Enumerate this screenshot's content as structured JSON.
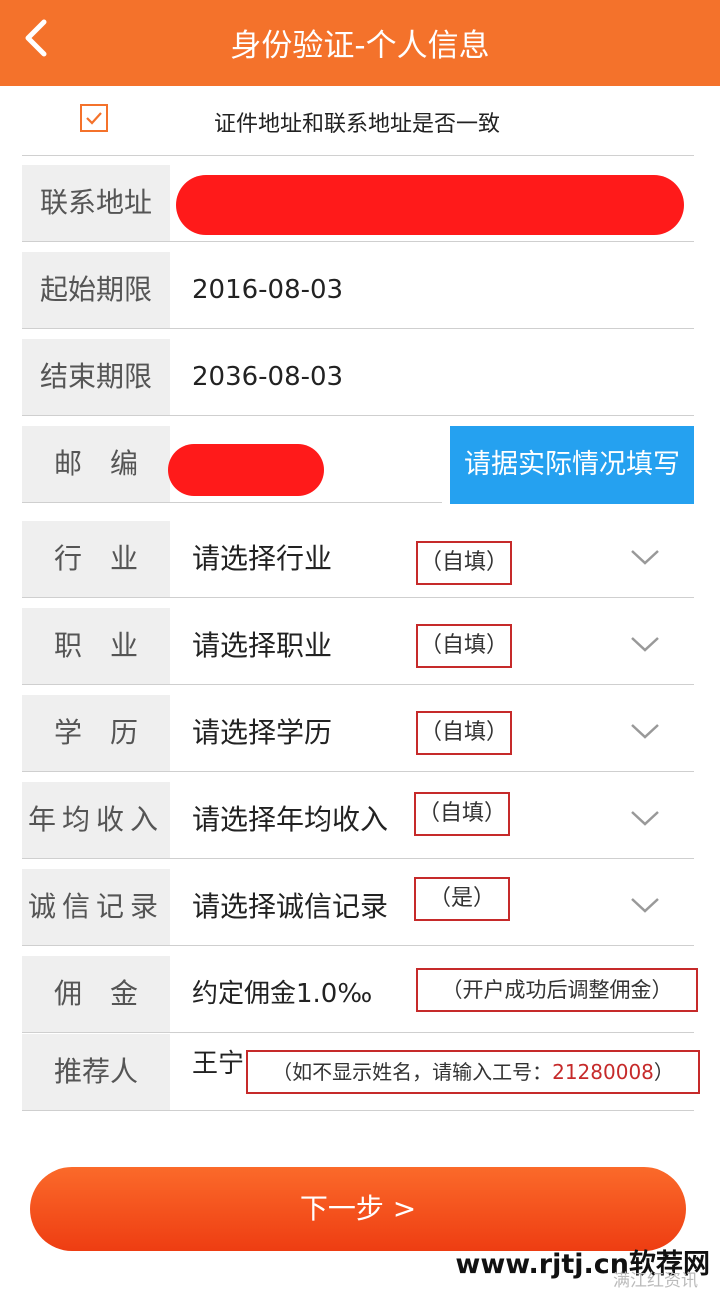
{
  "header": {
    "title": "身份验证-个人信息"
  },
  "same_address": {
    "label": "证件地址和联系地址是否一致",
    "checked": true
  },
  "fields": {
    "address": {
      "label": "联系地址"
    },
    "start": {
      "label": "起始期限",
      "value": "2016-08-03"
    },
    "end": {
      "label": "结束期限",
      "value": "2036-08-03"
    },
    "zip": {
      "label": "邮　编"
    },
    "industry": {
      "label": "行　业",
      "value": "请选择行业",
      "note": "（自填）"
    },
    "job": {
      "label": "职　业",
      "value": "请选择职业",
      "note": "（自填）"
    },
    "edu": {
      "label": "学　历",
      "value": "请选择学历",
      "note": "（自填）"
    },
    "income": {
      "label": "年均收入",
      "value": "请选择年均收入",
      "note": "（自填）"
    },
    "credit": {
      "label": "诚信记录",
      "value": "请选择诚信记录",
      "note": "（是）"
    },
    "commission": {
      "label": "佣　金",
      "value": "约定佣金1.0‰",
      "note": "（开户成功后调整佣金）"
    },
    "referrer": {
      "label": "推荐人",
      "value": "王宁",
      "note_prefix": "（如不显示姓名，请输入工号：",
      "note_code": "21280008",
      "note_suffix": "）"
    }
  },
  "hint_button": "请据实际情况填写",
  "next_button": "下一步 >",
  "watermark": "www.rjtj.cn软荐网",
  "watermark_small": "满江红资讯"
}
